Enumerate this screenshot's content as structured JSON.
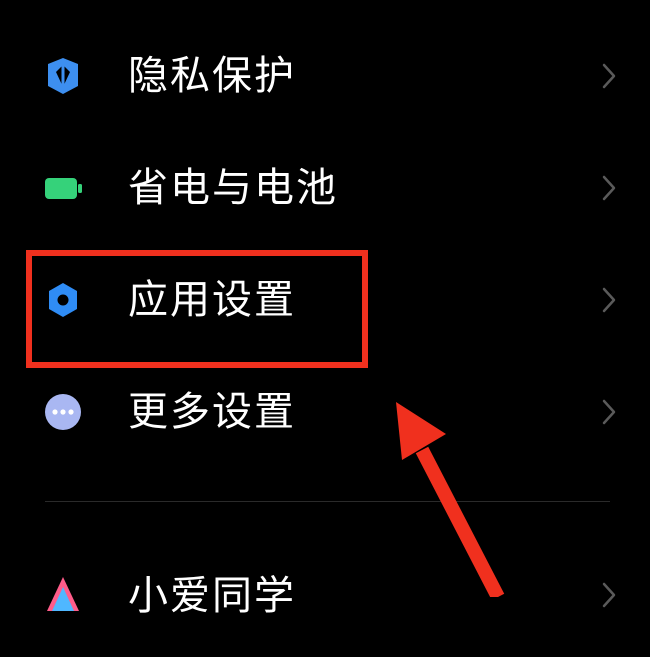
{
  "settings": {
    "items": [
      {
        "label": "隐私保护",
        "icon": "privacy-shield-icon",
        "icon_color": "#3d8ff0"
      },
      {
        "label": "省电与电池",
        "icon": "battery-icon",
        "icon_color": "#35d27a"
      },
      {
        "label": "应用设置",
        "icon": "gear-icon",
        "icon_color": "#2f8cf5"
      },
      {
        "label": "更多设置",
        "icon": "more-dots-icon",
        "icon_color": "#a9b7f2"
      },
      {
        "label": "小爱同学",
        "icon": "xiaoai-icon",
        "icon_color": "#ff5c8a"
      }
    ],
    "chevron_color": "#5a5a5a"
  },
  "annotation": {
    "highlight_color": "#f0301e",
    "highlighted_item": "应用设置"
  },
  "theme": {
    "background": "#000000",
    "text": "#ffffff"
  }
}
